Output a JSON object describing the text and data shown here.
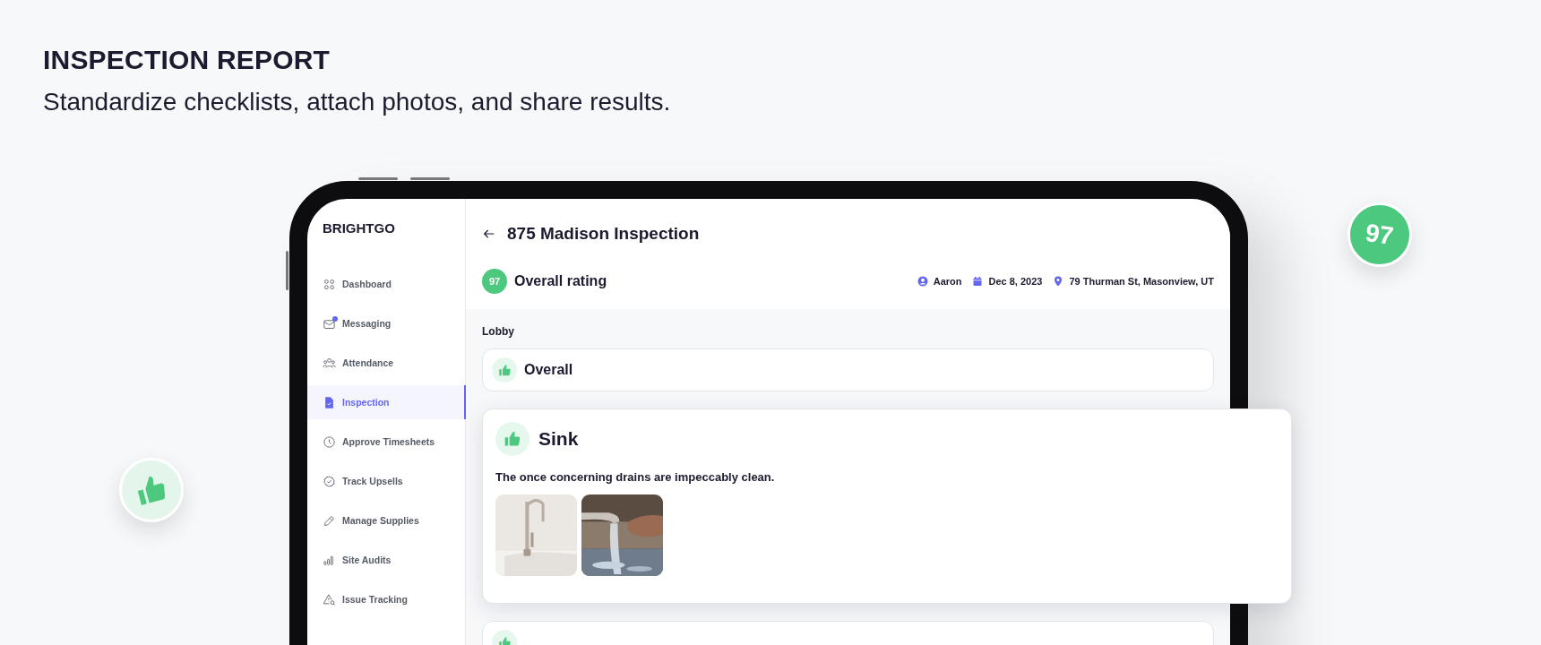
{
  "header": {
    "title": "INSPECTION REPORT",
    "subtitle": "Standardize checklists, attach photos, and share results."
  },
  "floating_badges": [
    {
      "kind": "thumb"
    },
    {
      "kind": "score",
      "text": "97"
    }
  ],
  "app": {
    "brand": "BRIGHTGO",
    "sidebar": {
      "items": [
        {
          "label": "Dashboard",
          "selected": false,
          "unread": false
        },
        {
          "label": "Messaging",
          "selected": false,
          "unread": true
        },
        {
          "label": "Attendance",
          "selected": false,
          "unread": false
        },
        {
          "label": "Inspection",
          "selected": true,
          "unread": false
        },
        {
          "label": "Approve Timesheets",
          "selected": false,
          "unread": false
        },
        {
          "label": "Track Upsells",
          "selected": false,
          "unread": false
        },
        {
          "label": "Manage Supplies",
          "selected": false,
          "unread": false
        },
        {
          "label": "Site Audits",
          "selected": false,
          "unread": false
        },
        {
          "label": "Issue Tracking",
          "selected": false,
          "unread": false
        }
      ]
    },
    "page": {
      "title": "875 Madison Inspection",
      "rating": "97",
      "rating_label": "Overall rating",
      "meta": [
        {
          "kind": "person",
          "text": "Aaron"
        },
        {
          "kind": "date",
          "text": "Dec 8, 2023"
        },
        {
          "kind": "location",
          "text": "79 Thurman St, Masonview, UT"
        }
      ],
      "section": "Lobby",
      "items": [
        {
          "title": "Overall",
          "expanded": false
        },
        {
          "title": "Sink",
          "expanded": true,
          "note": "The once concerning drains are impeccably clean."
        },
        {
          "expanded": false
        }
      ]
    }
  }
}
